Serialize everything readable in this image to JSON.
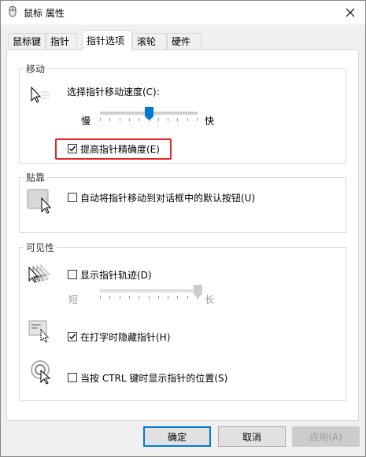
{
  "window": {
    "title": "鼠标 属性"
  },
  "tabs": [
    {
      "label": "鼠标键"
    },
    {
      "label": "指针"
    },
    {
      "label": "指针选项"
    },
    {
      "label": "滚轮"
    },
    {
      "label": "硬件"
    }
  ],
  "motion": {
    "group_label": "移动",
    "speed_label": "选择指针移动速度(C):",
    "slow": "慢",
    "fast": "快",
    "speed_level": 0.5,
    "precision_label": "提高指针精确度(E)",
    "precision_checked": true
  },
  "snap": {
    "group_label": "贴靠",
    "label": "自动将指针移动到对话框中的默认按钮(U)",
    "checked": false
  },
  "visibility": {
    "group_label": "可见性",
    "trails_label": "显示指针轨迹(D)",
    "trails_checked": false,
    "short": "短",
    "long": "长",
    "trail_level": 1.0,
    "hide_label": "在打字时隐藏指针(H)",
    "hide_checked": true,
    "ctrl_label": "当按 CTRL 键时显示指针的位置(S)",
    "ctrl_checked": false
  },
  "buttons": {
    "ok": "确定",
    "cancel": "取消",
    "apply": "应用(A)"
  },
  "colors": {
    "accent": "#0078d7",
    "highlight": "#e3262a"
  }
}
